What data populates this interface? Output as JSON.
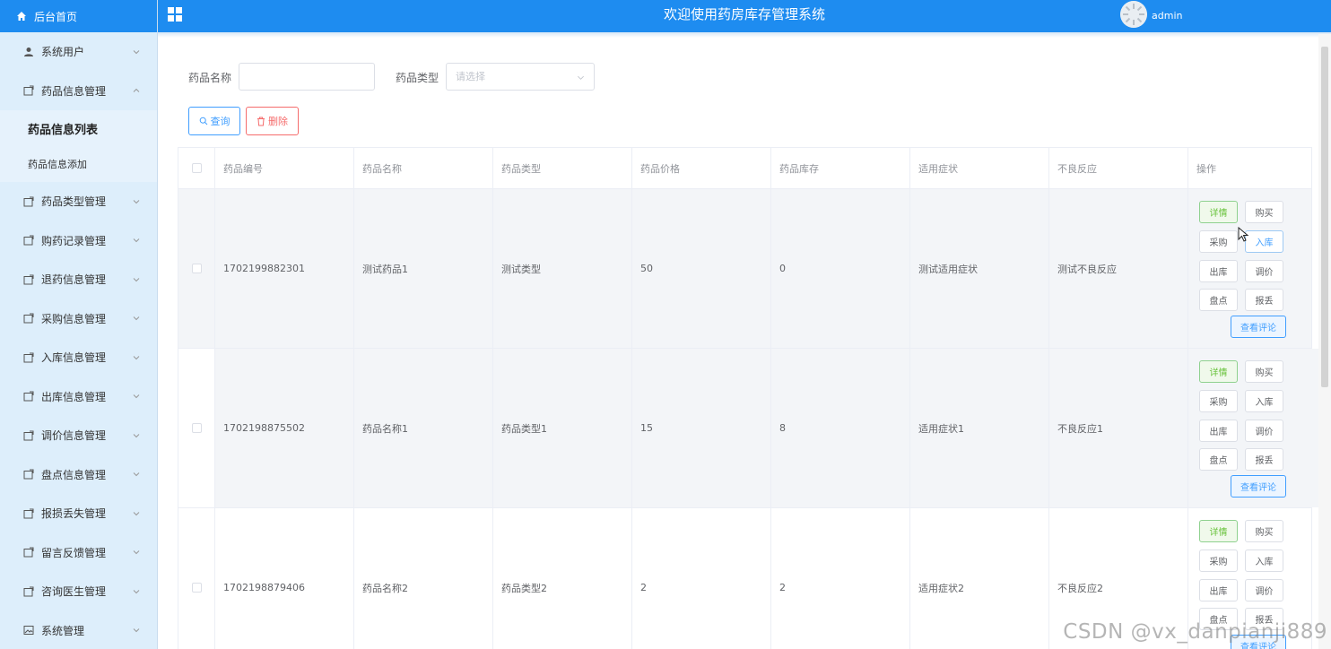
{
  "sidebar": {
    "home_label": "后台首页",
    "items": [
      {
        "label": "系统用户"
      },
      {
        "label": "药品信息管理"
      },
      {
        "label": "药品类型管理"
      },
      {
        "label": "购药记录管理"
      },
      {
        "label": "退药信息管理"
      },
      {
        "label": "采购信息管理"
      },
      {
        "label": "入库信息管理"
      },
      {
        "label": "出库信息管理"
      },
      {
        "label": "调价信息管理"
      },
      {
        "label": "盘点信息管理"
      },
      {
        "label": "报损丢失管理"
      },
      {
        "label": "留言反馈管理"
      },
      {
        "label": "咨询医生管理"
      },
      {
        "label": "系统管理"
      }
    ],
    "sub_items": [
      {
        "label": "药品信息列表"
      },
      {
        "label": "药品信息添加"
      }
    ]
  },
  "header": {
    "title": "欢迎使用药房库存管理系统",
    "username": "admin"
  },
  "search": {
    "name_label": "药品名称",
    "name_value": "",
    "type_label": "药品类型",
    "type_placeholder": "请选择",
    "query_button": "查询",
    "delete_button": "删除"
  },
  "table": {
    "headers": [
      "药品编号",
      "药品名称",
      "药品类型",
      "药品价格",
      "药品库存",
      "适用症状",
      "不良反应",
      "操作"
    ],
    "rows": [
      [
        "1702199882301",
        "测试药品1",
        "测试类型",
        "50",
        "0",
        "测试适用症状",
        "测试不良反应"
      ],
      [
        "1702198875502",
        "药品名称1",
        "药品类型1",
        "15",
        "8",
        "适用症状1",
        "不良反应1"
      ],
      [
        "1702198879406",
        "药品名称2",
        "药品类型2",
        "2",
        "2",
        "适用症状2",
        "不良反应2"
      ]
    ],
    "actions": {
      "detail": "详情",
      "buy": "购买",
      "purchase": "采购",
      "stock_in": "入库",
      "stock_out": "出库",
      "price_adjust": "调价",
      "inventory": "盘点",
      "report_loss": "报丢",
      "view_comments": "查看评论"
    }
  },
  "watermark": "CSDN @vx_danpianji889",
  "colors": {
    "primary": "#1e8cf0",
    "sidebar_bg": "#ddeefb",
    "danger": "#f56c6c",
    "success": "#67c23a"
  }
}
